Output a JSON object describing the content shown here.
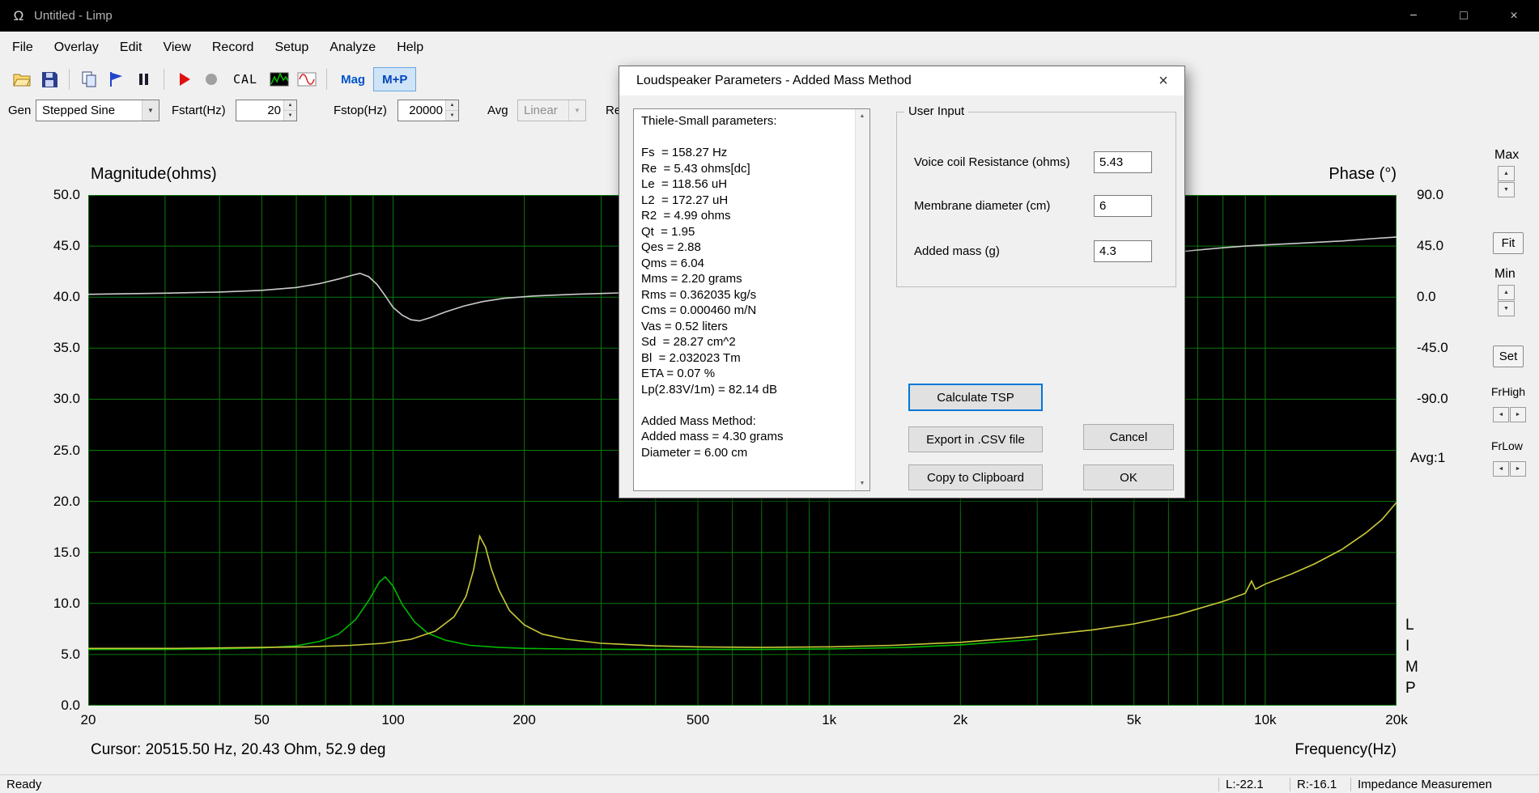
{
  "window": {
    "title": "Untitled - Limp"
  },
  "icons": {
    "omega": "Ω",
    "minimize": "−",
    "maximize": "□",
    "close": "×",
    "dialog_close": "×",
    "dropdown": "▼",
    "up_arrow": "▲",
    "down_arrow": "▼",
    "left_arrow": "◄",
    "right_arrow": "►",
    "scroll_up": "▲",
    "scroll_down": "▼"
  },
  "menu": [
    "File",
    "Overlay",
    "Edit",
    "View",
    "Record",
    "Setup",
    "Analyze",
    "Help"
  ],
  "toolbar": {
    "cal_label": "CAL",
    "mag_label": "Mag",
    "mp_label": "M+P"
  },
  "generator": {
    "gen_label": "Gen",
    "type_value": "Stepped Sine",
    "fstart_label": "Fstart(Hz)",
    "fstart_value": "20",
    "fstop_label": "Fstop(Hz)",
    "fstop_value": "20000",
    "avg_label": "Avg",
    "avg_value": "Linear",
    "ref_label": "Re"
  },
  "chart": {
    "magnitude_title": "Magnitude(ohms)",
    "phase_title": "Phase (°)",
    "xlabel": "Frequency(Hz)",
    "cursor_readout": "Cursor: 20515.50 Hz, 20.43 Ohm, 52.9 deg",
    "avg_indicator": "Avg:1",
    "logo_letters": "LIMP"
  },
  "side_panel": {
    "max_label": "Max",
    "fit_label": "Fit",
    "min_label": "Min",
    "set_label": "Set",
    "frhigh_label": "FrHigh",
    "frlow_label": "FrLow"
  },
  "status_bar": {
    "ready": "Ready",
    "left_level": "L:-22.1",
    "right_level": "R:-16.1",
    "mode": "Impedance Measuremen"
  },
  "dialog": {
    "title": "Loudspeaker Parameters - Added Mass Method",
    "results_lines": [
      "Thiele-Small parameters:",
      "",
      "Fs  = 158.27 Hz",
      "Re  = 5.43 ohms[dc]",
      "Le  = 118.56 uH",
      "L2  = 172.27 uH",
      "R2  = 4.99 ohms",
      "Qt  = 1.95",
      "Qes = 2.88",
      "Qms = 6.04",
      "Mms = 2.20 grams",
      "Rms = 0.362035 kg/s",
      "Cms = 0.000460 m/N",
      "Vas = 0.52 liters",
      "Sd  = 28.27 cm^2",
      "Bl  = 2.032023 Tm",
      "ETA = 0.07 %",
      "Lp(2.83V/1m) = 82.14 dB",
      "",
      "Added Mass Method:",
      "Added mass = 4.30 grams",
      "Diameter = 6.00 cm"
    ],
    "user_input": {
      "title": "User Input",
      "rows": [
        {
          "label": "Voice coil Resistance (ohms)",
          "value": "5.43"
        },
        {
          "label": "Membrane diameter (cm)",
          "value": "6"
        },
        {
          "label": "Added mass (g)",
          "value": "4.3"
        }
      ]
    },
    "buttons": {
      "calculate": "Calculate TSP",
      "export": "Export in .CSV file",
      "copy": "Copy to Clipboard",
      "cancel": "Cancel",
      "ok": "OK"
    }
  },
  "chart_data": {
    "type": "line",
    "x_scale": "log",
    "x_range": [
      20,
      20000
    ],
    "x_ticks": [
      "20",
      "50",
      "100",
      "200",
      "500",
      "1k",
      "2k",
      "5k",
      "10k",
      "20k"
    ],
    "x_tick_values": [
      20,
      50,
      100,
      200,
      500,
      1000,
      2000,
      5000,
      10000,
      20000
    ],
    "y_left": {
      "label": "Magnitude(ohms)",
      "min": 0,
      "max": 50,
      "step": 5
    },
    "y_right": {
      "label": "Phase (°)",
      "ticks": [
        90,
        45,
        0,
        -45,
        -90
      ],
      "mag_at_zero": 40,
      "deg_per_mag": 9
    },
    "grid_color": "#0b7a0b",
    "plot_bg": "#000000",
    "series": [
      {
        "name": "overlay-magnitude-added-mass",
        "color": "#00b900",
        "axis": "left",
        "unit": "ohm",
        "points": [
          [
            20,
            5.5
          ],
          [
            30,
            5.5
          ],
          [
            40,
            5.55
          ],
          [
            50,
            5.65
          ],
          [
            60,
            5.85
          ],
          [
            68,
            6.3
          ],
          [
            75,
            7.0
          ],
          [
            82,
            8.4
          ],
          [
            88,
            10.3
          ],
          [
            93,
            12.1
          ],
          [
            96,
            12.6
          ],
          [
            100,
            11.7
          ],
          [
            105,
            9.9
          ],
          [
            112,
            8.2
          ],
          [
            120,
            7.1
          ],
          [
            132,
            6.4
          ],
          [
            150,
            5.9
          ],
          [
            175,
            5.7
          ],
          [
            200,
            5.6
          ],
          [
            250,
            5.55
          ],
          [
            350,
            5.5
          ],
          [
            500,
            5.5
          ],
          [
            700,
            5.5
          ],
          [
            1000,
            5.55
          ],
          [
            1500,
            5.7
          ],
          [
            2000,
            5.95
          ],
          [
            3000,
            6.5
          ]
        ]
      },
      {
        "name": "magnitude-free-air",
        "color": "#c9c93a",
        "axis": "left",
        "unit": "ohm",
        "points": [
          [
            20,
            5.6
          ],
          [
            25,
            5.6
          ],
          [
            32,
            5.6
          ],
          [
            40,
            5.65
          ],
          [
            50,
            5.7
          ],
          [
            63,
            5.75
          ],
          [
            80,
            5.9
          ],
          [
            95,
            6.1
          ],
          [
            110,
            6.5
          ],
          [
            125,
            7.3
          ],
          [
            138,
            8.7
          ],
          [
            147,
            10.7
          ],
          [
            153,
            13.3
          ],
          [
            158,
            16.6
          ],
          [
            163,
            15.5
          ],
          [
            168,
            13.4
          ],
          [
            175,
            11.3
          ],
          [
            185,
            9.3
          ],
          [
            200,
            7.9
          ],
          [
            220,
            7.0
          ],
          [
            250,
            6.5
          ],
          [
            300,
            6.1
          ],
          [
            400,
            5.85
          ],
          [
            500,
            5.75
          ],
          [
            700,
            5.7
          ],
          [
            1000,
            5.75
          ],
          [
            1400,
            5.9
          ],
          [
            2000,
            6.2
          ],
          [
            2800,
            6.7
          ],
          [
            4000,
            7.4
          ],
          [
            5000,
            8.0
          ],
          [
            6300,
            8.9
          ],
          [
            8000,
            10.2
          ],
          [
            9000,
            11.0
          ],
          [
            9300,
            12.2
          ],
          [
            9500,
            11.4
          ],
          [
            10000,
            11.9
          ],
          [
            11500,
            12.9
          ],
          [
            13000,
            13.9
          ],
          [
            15000,
            15.3
          ],
          [
            17000,
            16.9
          ],
          [
            18500,
            18.2
          ],
          [
            20000,
            19.9
          ]
        ]
      },
      {
        "name": "phase",
        "color": "#cbcbcb",
        "axis": "right",
        "unit": "deg",
        "points": [
          [
            20,
            2.5
          ],
          [
            30,
            3.5
          ],
          [
            40,
            4.5
          ],
          [
            50,
            6
          ],
          [
            60,
            8.5
          ],
          [
            68,
            12
          ],
          [
            75,
            16
          ],
          [
            80,
            19
          ],
          [
            84,
            21
          ],
          [
            88,
            18
          ],
          [
            92,
            11
          ],
          [
            96,
            1
          ],
          [
            100,
            -9
          ],
          [
            105,
            -16
          ],
          [
            110,
            -20
          ],
          [
            115,
            -21
          ],
          [
            122,
            -18
          ],
          [
            132,
            -13
          ],
          [
            145,
            -8
          ],
          [
            160,
            -4
          ],
          [
            180,
            -1
          ],
          [
            210,
            1
          ],
          [
            260,
            2.5
          ],
          [
            350,
            4
          ],
          [
            500,
            6.5
          ],
          [
            800,
            11
          ],
          [
            1300,
            16
          ],
          [
            2000,
            22
          ],
          [
            3000,
            28
          ],
          [
            4500,
            34
          ],
          [
            6000,
            39
          ],
          [
            7000,
            41.5
          ],
          [
            8000,
            43.5
          ],
          [
            9000,
            45
          ],
          [
            10000,
            46
          ],
          [
            12000,
            47.5
          ],
          [
            15000,
            49.5
          ],
          [
            17500,
            51.5
          ],
          [
            20000,
            53
          ]
        ]
      }
    ]
  }
}
